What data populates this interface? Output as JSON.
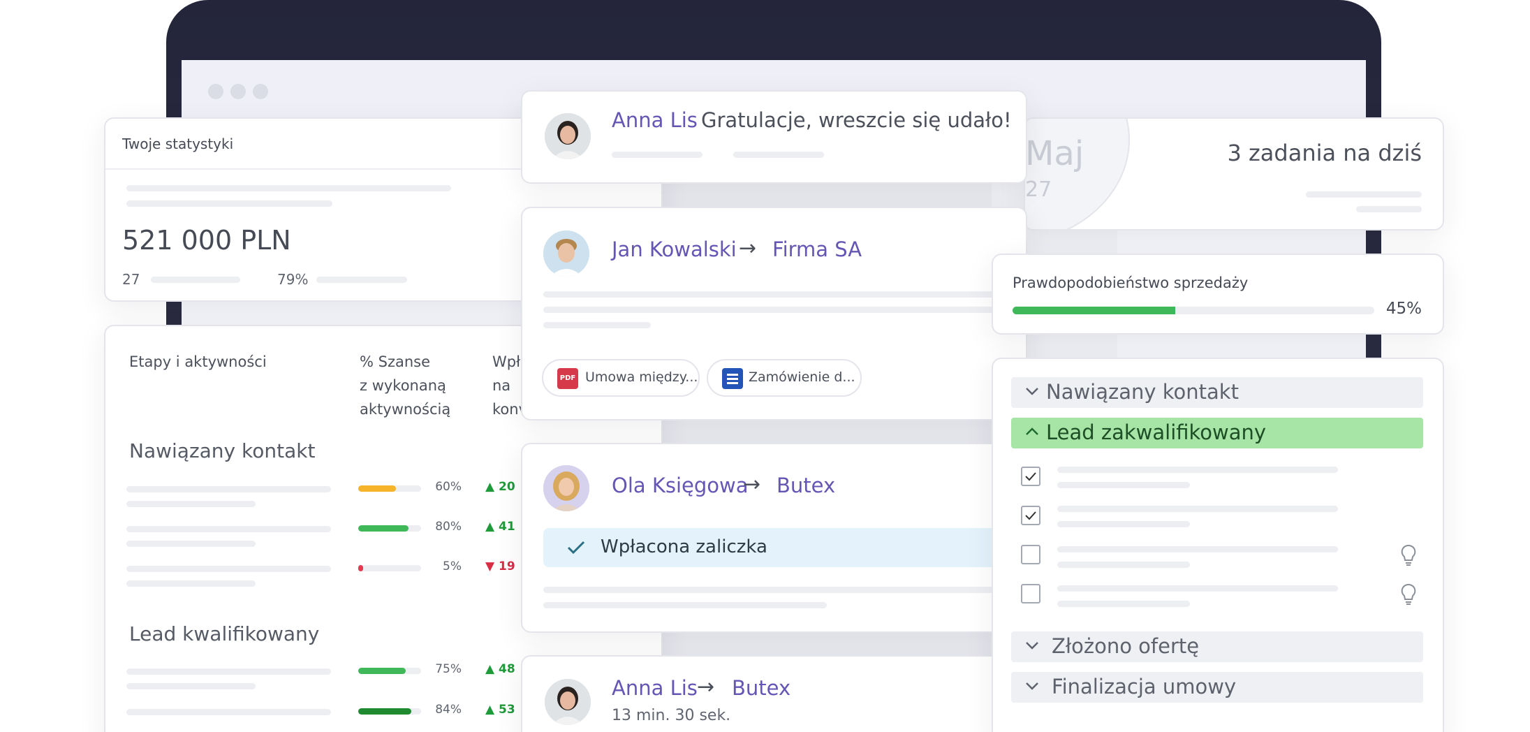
{
  "stats": {
    "title": "Twoje statystyki",
    "amount": "521 000 PLN",
    "count": "27",
    "percent": "79%"
  },
  "stages_table": {
    "headers": {
      "stage": "Etapy i aktywności",
      "chance": [
        "% Szanse",
        "z wykonaną",
        "aktywnością"
      ],
      "paid": [
        "Wpł",
        "na",
        "konv"
      ]
    },
    "groups": [
      {
        "title": "Nawiązany kontakt",
        "rows": [
          {
            "pct": "60%",
            "value": 60,
            "color": "#f5b42a",
            "trend": "up",
            "trend_text": "20"
          },
          {
            "pct": "80%",
            "value": 80,
            "color": "#3fb85a",
            "trend": "up",
            "trend_text": "41"
          },
          {
            "pct": "5%",
            "value": 5,
            "color": "#e23b52",
            "trend": "down",
            "trend_text": "19"
          }
        ]
      },
      {
        "title": "Lead kwalifikowany",
        "rows": [
          {
            "pct": "75%",
            "value": 75,
            "color": "#3fb85a",
            "trend": "up",
            "trend_text": "48"
          },
          {
            "pct": "84%",
            "value": 84,
            "color": "#1f8a30",
            "trend": "up",
            "trend_text": "53"
          }
        ]
      }
    ]
  },
  "feed": {
    "message": {
      "name": "Anna Lis",
      "text": "Gratulacje, wreszcie się udało!"
    },
    "deal1": {
      "name": "Jan Kowalski",
      "arrow": "→",
      "company": "Firma SA",
      "attachments": [
        {
          "icon": "pdf-icon",
          "icon_label": "PDF",
          "label": "Umowa między..."
        },
        {
          "icon": "document-icon",
          "label": "Zamówienie d..."
        }
      ]
    },
    "deal2": {
      "name": "Ola Księgowa",
      "arrow": "→",
      "company": "Butex",
      "status": "Wpłacona zaliczka"
    },
    "deal3": {
      "name": "Anna Lis",
      "arrow": "→",
      "company": "Butex",
      "time": "13 min. 30 sek."
    }
  },
  "calendar": {
    "month": "Maj",
    "day": "27",
    "tasks": "3 zadania na dziś"
  },
  "probability": {
    "title": "Prawdopodobieństwo sprzedaży",
    "value": 45,
    "label": "45%"
  },
  "pipeline": {
    "stages": [
      {
        "label": "Nawiązany kontakt",
        "state": "collapsed"
      },
      {
        "label": "Lead zakwalifikowany",
        "state": "expanded"
      },
      {
        "label": "Złożono ofertę",
        "state": "collapsed"
      },
      {
        "label": "Finalizacja umowy",
        "state": "collapsed"
      }
    ],
    "checklist": [
      {
        "checked": true,
        "hint": false
      },
      {
        "checked": true,
        "hint": false
      },
      {
        "checked": false,
        "hint": true
      },
      {
        "checked": false,
        "hint": true
      }
    ]
  },
  "colors": {
    "accent": "#6555b5",
    "success": "#3fb85a",
    "active_stage_bg": "#a6e5a6",
    "info_bg": "#e3f2fb"
  }
}
